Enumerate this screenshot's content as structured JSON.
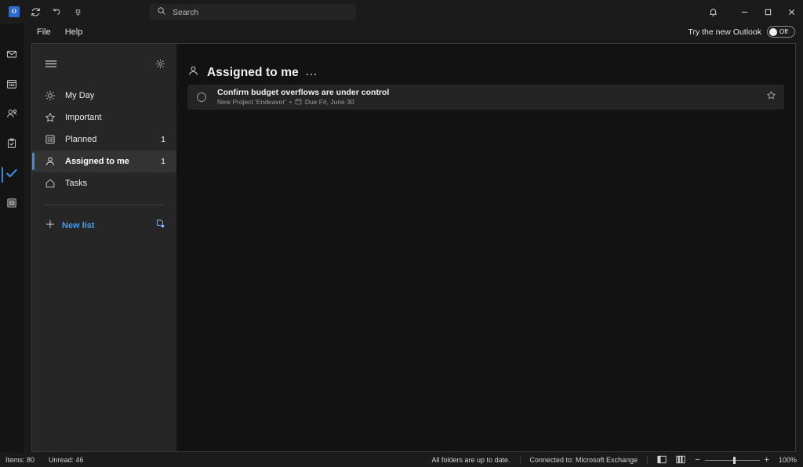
{
  "titlebar": {
    "quick_access": [
      {
        "name": "outlook-logo-icon",
        "label": "O"
      },
      {
        "name": "send-receive-icon",
        "label": ""
      },
      {
        "name": "undo-icon",
        "label": ""
      },
      {
        "name": "customize-quick-access-toolbar-icon",
        "label": ""
      }
    ],
    "search": {
      "placeholder": "Search",
      "value": "",
      "icon": "search-icon"
    },
    "notifications_icon": "bell-icon",
    "minimize_icon": "minimize-icon",
    "maximize_icon": "maximize-icon",
    "close_icon": "close-icon"
  },
  "menubar": {
    "items": [
      {
        "label": "File"
      },
      {
        "label": "Help"
      }
    ],
    "new_outlook": {
      "label": "Try the new Outlook",
      "toggle_state": "Off"
    }
  },
  "rail": {
    "items": [
      {
        "name": "mail",
        "icon": "mail-icon",
        "selected": false
      },
      {
        "name": "calendar",
        "icon": "calendar-icon",
        "selected": false
      },
      {
        "name": "people",
        "icon": "people-icon",
        "selected": false
      },
      {
        "name": "tasks",
        "icon": "clipboard-check-icon",
        "selected": false
      },
      {
        "name": "todo",
        "icon": "checkmark-icon",
        "selected": true
      },
      {
        "name": "more-apps",
        "icon": "apps-grid-icon",
        "selected": false
      }
    ]
  },
  "sidebar": {
    "menu_icon": "hamburger-menu-icon",
    "settings_icon": "gear-icon",
    "items": [
      {
        "label": "My Day",
        "icon": "sun-icon",
        "badge": "",
        "selected": false
      },
      {
        "label": "Important",
        "icon": "star-icon",
        "badge": "",
        "selected": false
      },
      {
        "label": "Planned",
        "icon": "planned-list-icon",
        "badge": "1",
        "selected": false
      },
      {
        "label": "Assigned to me",
        "icon": "person-icon",
        "badge": "1",
        "selected": true
      },
      {
        "label": "Tasks",
        "icon": "home-icon",
        "badge": "",
        "selected": false
      }
    ],
    "new_list": {
      "label": "New list",
      "plus_icon": "plus-icon",
      "new_group_icon": "new-group-icon"
    }
  },
  "main": {
    "header": {
      "title": "Assigned to me",
      "icon": "person-icon",
      "more_options_icon": "more-options-icon"
    },
    "tasks": [
      {
        "title": "Confirm budget overflows are under control",
        "source": "New Project 'Endeavor'",
        "separator": "•",
        "due": "Due Fri, June 30",
        "due_icon": "calendar-small-icon",
        "checkbox_icon": "circle-checkbox-icon",
        "star_icon": "star-outline-icon",
        "completed": false,
        "important": false
      }
    ]
  },
  "statusbar": {
    "items_count": "Items: 80",
    "unread_count": "Unread: 46",
    "sync_status": "All folders are up to date.",
    "connection": "Connected to: Microsoft Exchange",
    "normal_view_icon": "normal-view-icon",
    "reading_view_icon": "reading-view-icon",
    "zoom_out_label": "−",
    "zoom_in_label": "+",
    "zoom_level": "100%"
  },
  "colors": {
    "accent": "#3a8ce0",
    "link": "#4a9ae6",
    "selected_row_bg": "#333333",
    "sidebar_bg": "#262626",
    "main_bg": "#121212",
    "task_bg": "#242424"
  }
}
